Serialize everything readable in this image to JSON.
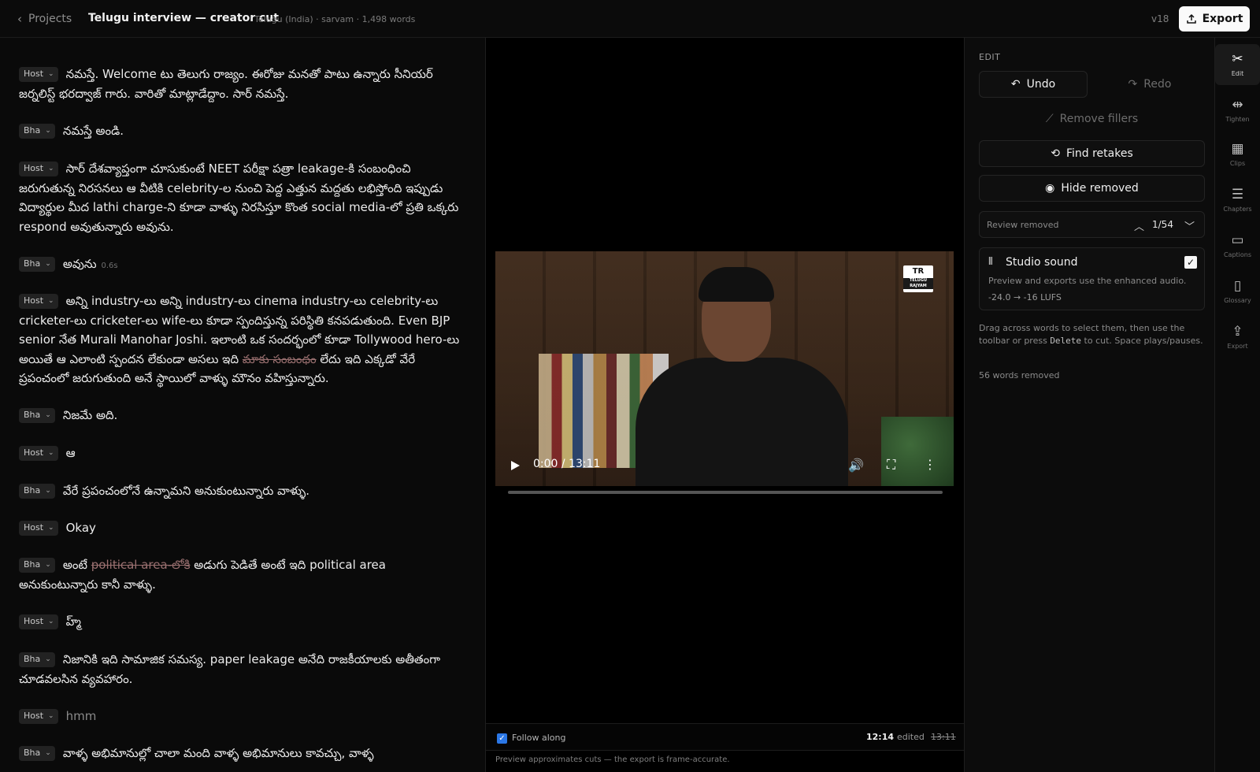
{
  "header": {
    "back_label": "Projects",
    "title": "Telugu interview — creator cut",
    "meta": "Telugu (India) · sarvam · 1,498 words",
    "version": "v18",
    "export_label": "Export"
  },
  "transcript": [
    {
      "speaker": "Host",
      "text": "నమస్తే. Welcome టు తెలుగు రాజ్యం. ఈరోజు మనతో పాటు ఉన్నారు సీనియర్ జర్నలిస్ట్ భరద్వాజ్ గారు. వారితో మాట్లాడేద్దాం. సార్ నమస్తే."
    },
    {
      "speaker": "Bha",
      "text": "నమస్తే అండి."
    },
    {
      "speaker": "Host",
      "text": "సార్ దేశవ్యాప్తంగా చూసుకుంటే NEET పరీక్షా పత్రా leakage-కి సంబంధించి జరుగుతున్న నిరసనలు ఆ వీటికి celebrity-ల నుంచి పెద్ద ఎత్తున మద్దతు లభిస్తోంది ఇప్పుడు విద్యార్థుల మీద lathi charge-ని కూడా వాళ్ళు నిరసిస్తూ కొంత social media-లో ప్రతి ఒక్కరు respond అవుతున్నారు అవును."
    },
    {
      "speaker": "Bha",
      "text": "అవును",
      "gap": "0.6s"
    },
    {
      "speaker": "Host",
      "text_before": "అన్ని industry-లు అన్ని industry-లు cinema industry-లు celebrity-లు cricketer-లు cricketer-లు wife-లు కూడా స్పందిస్తున్న పరిస్థితి కనపడుతుంది. Even BJP senior నేత Murali Manohar Joshi. ఇలాంటి ఒక సందర్భంలో కూడా Tollywood hero-లు అయితే ఆ ఎలాంటి స్పందన లేకుండా అసలు ఇది ",
      "removed": "మాకు సంబంధం",
      "text_after": " లేదు ఇది ఎక్కడో వేరే ప్రపంచంలో జరుగుతుంది అనే స్థాయిలో వాళ్ళు మౌనం వహిస్తున్నారు."
    },
    {
      "speaker": "Bha",
      "text": "నిజమే అది."
    },
    {
      "speaker": "Host",
      "text": "ఆ"
    },
    {
      "speaker": "Bha",
      "text": "వేరే ప్రపంచంలోనే ఉన్నామని అనుకుంటున్నారు వాళ్ళు."
    },
    {
      "speaker": "Host",
      "text": "Okay"
    },
    {
      "speaker": "Bha",
      "text_before": "అంటే ",
      "removed": "political area-లోకి",
      "text_after": " అడుగు పెడితే అంటే ఇది political area అనుకుంటున్నారు కానీ వాళ్ళు."
    },
    {
      "speaker": "Host",
      "text": "హ్మ్"
    },
    {
      "speaker": "Bha",
      "text": "నిజానికి ఇది సామాజిక సమస్య. paper leakage అనేది రాజకీయాలకు అతీతంగా చూడవలసిన వ్యవహారం."
    },
    {
      "speaker": "Host",
      "text": "hmm"
    },
    {
      "speaker": "Bha",
      "text": "వాళ్ళ అభిమానుల్లో చాలా మంది వాళ్ళ అభిమానులు కావచ్చు, వాళ్ళ"
    }
  ],
  "video": {
    "time": "0:00 / 13:11",
    "progress": 0,
    "logo_text": "TR",
    "logo_sub": "TELUGU RAJYAM"
  },
  "follow": {
    "label": "Follow along",
    "checked": true,
    "edited_time": "12:14",
    "edited_word": "edited",
    "original_time": "13:11"
  },
  "preview_note": "Preview approximates cuts — the export is frame-accurate.",
  "edit_panel": {
    "title": "EDIT",
    "undo": "Undo",
    "redo": "Redo",
    "remove_fillers": "Remove fillers",
    "find_retakes": "Find retakes",
    "hide_removed": "Hide removed",
    "review_label": "Review removed",
    "review_count": "1/54",
    "studio_title": "Studio sound",
    "studio_checked": true,
    "studio_desc": "Preview and exports use the enhanced audio.",
    "studio_lufs": "-24.0 → -16 LUFS",
    "help_before": "Drag across words to select them, then use the toolbar or press ",
    "help_key": "Delete",
    "help_after": " to cut. Space plays/pauses.",
    "words_removed": "56 words removed"
  },
  "rail": [
    {
      "label": "Edit",
      "icon": "scissors-icon",
      "glyph": "✂",
      "active": true
    },
    {
      "label": "Tighten",
      "icon": "tighten-icon",
      "glyph": "⇹",
      "active": false
    },
    {
      "label": "Clips",
      "icon": "film-icon",
      "glyph": "▦",
      "active": false
    },
    {
      "label": "Chapters",
      "icon": "list-icon",
      "glyph": "☰",
      "active": false
    },
    {
      "label": "Captions",
      "icon": "captions-icon",
      "glyph": "▭",
      "active": false
    },
    {
      "label": "Glossary",
      "icon": "book-icon",
      "glyph": "▯",
      "active": false
    },
    {
      "label": "Export",
      "icon": "upload-icon",
      "glyph": "⇪",
      "active": false
    }
  ],
  "colors": {
    "background": "#0a0a0a",
    "accent_blue": "#2b77e6",
    "removed_text": "#9a7070",
    "export_button": "#fafafa"
  }
}
